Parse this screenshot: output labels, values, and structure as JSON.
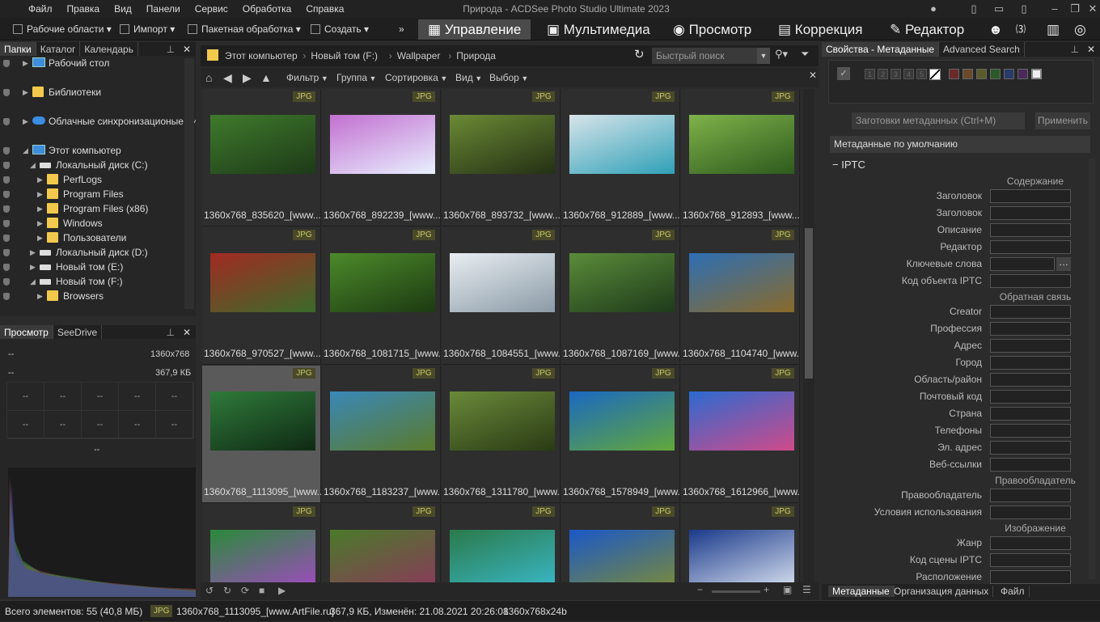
{
  "window": {
    "title": "Природа - ACDSee Photo Studio Ultimate 2023"
  },
  "menu": [
    "Файл",
    "Правка",
    "Вид",
    "Панели",
    "Сервис",
    "Обработка",
    "Справка"
  ],
  "toolbar": {
    "workspaces": "Рабочие области",
    "import": "Импорт",
    "batch": "Пакетная обработка",
    "create": "Создать",
    "more": "»"
  },
  "modes": [
    "Управление",
    "Мультимедиа",
    "Просмотр",
    "Коррекция",
    "Редактор"
  ],
  "left_tabs": [
    "Папки",
    "Каталог",
    "Календарь"
  ],
  "tree": [
    {
      "label": "Рабочий стол",
      "indent": 0,
      "icon": "desktop"
    },
    {
      "label": "Библиотеки",
      "indent": 0,
      "icon": "folder"
    },
    {
      "label": "Облачные синхронизационые ди",
      "indent": 0,
      "icon": "cloud"
    },
    {
      "label": "Этот компьютер",
      "indent": 0,
      "icon": "computer"
    },
    {
      "label": "Локальный диск (C:)",
      "indent": 1,
      "icon": "drive"
    },
    {
      "label": "PerfLogs",
      "indent": 2,
      "icon": "folder"
    },
    {
      "label": "Program Files",
      "indent": 2,
      "icon": "folder"
    },
    {
      "label": "Program Files (x86)",
      "indent": 2,
      "icon": "folder"
    },
    {
      "label": "Windows",
      "indent": 2,
      "icon": "folder"
    },
    {
      "label": "Пользователи",
      "indent": 2,
      "icon": "folder"
    },
    {
      "label": "Локальный диск (D:)",
      "indent": 1,
      "icon": "drive"
    },
    {
      "label": "Новый том (E:)",
      "indent": 1,
      "icon": "drive"
    },
    {
      "label": "Новый том (F:)",
      "indent": 1,
      "icon": "drive"
    },
    {
      "label": "Browsers",
      "indent": 2,
      "icon": "folder"
    }
  ],
  "preview_tabs": [
    "Просмотр",
    "SeeDrive"
  ],
  "preview": {
    "dims": "1360x768",
    "size": "367,9 КБ",
    "dash": "--"
  },
  "breadcrumb": [
    "Этот компьютер",
    "Новый том (F:)",
    "Wallpaper",
    "Природа"
  ],
  "quick_search": {
    "placeholder": "Быстрый поиск"
  },
  "navbar": [
    "Фильтр",
    "Группа",
    "Сортировка",
    "Вид",
    "Выбор"
  ],
  "thumbs": [
    {
      "name": "1360x768_835620_[www....",
      "badge": "JPG",
      "c1": "#3f7a2c",
      "c2": "#1d3a18"
    },
    {
      "name": "1360x768_892239_[www....",
      "badge": "JPG",
      "c1": "#c26fd0",
      "c2": "#e8f0ff"
    },
    {
      "name": "1360x768_893732_[www....",
      "badge": "JPG",
      "c1": "#6b8a35",
      "c2": "#243014"
    },
    {
      "name": "1360x768_912889_[www....",
      "badge": "JPG",
      "c1": "#d7e4ea",
      "c2": "#2fa0b7"
    },
    {
      "name": "1360x768_912893_[www....",
      "badge": "JPG",
      "c1": "#7fb24a",
      "c2": "#2d5a1d"
    },
    {
      "name": "1360x768_970527_[www....",
      "badge": "JPG",
      "c1": "#a22a22",
      "c2": "#3b6b2a"
    },
    {
      "name": "1360x768_1081715_[www....",
      "badge": "JPG",
      "c1": "#4c8a2a",
      "c2": "#1c3a12"
    },
    {
      "name": "1360x768_1084551_[www....",
      "badge": "JPG",
      "c1": "#e9eef2",
      "c2": "#8a9aa6"
    },
    {
      "name": "1360x768_1087169_[www....",
      "badge": "JPG",
      "c1": "#5a8c3a",
      "c2": "#1e3a1a"
    },
    {
      "name": "1360x768_1104740_[www....",
      "badge": "JPG",
      "c1": "#2d6fb5",
      "c2": "#8a6a2a"
    },
    {
      "name": "1360x768_1113095_[www....",
      "badge": "JPG",
      "c1": "#2f7a3a",
      "c2": "#0f2a14",
      "selected": true
    },
    {
      "name": "1360x768_1183237_[www....",
      "badge": "JPG",
      "c1": "#3a88b8",
      "c2": "#5a7a2a"
    },
    {
      "name": "1360x768_1311780_[www....",
      "badge": "JPG",
      "c1": "#6a8a3a",
      "c2": "#2a3a14"
    },
    {
      "name": "1360x768_1578949_[www....",
      "badge": "JPG",
      "c1": "#1a68c2",
      "c2": "#62a83a"
    },
    {
      "name": "1360x768_1612966_[www....",
      "badge": "JPG",
      "c1": "#2c6ad0",
      "c2": "#d04a8a"
    },
    {
      "name": "",
      "badge": "JPG",
      "c1": "#2a8a3a",
      "c2": "#a04ac0"
    },
    {
      "name": "",
      "badge": "JPG",
      "c1": "#4a7a2a",
      "c2": "#8a3a5a"
    },
    {
      "name": "",
      "badge": "JPG",
      "c1": "#2a7a4a",
      "c2": "#3ab8c8"
    },
    {
      "name": "",
      "badge": "JPG",
      "c1": "#1a58c8",
      "c2": "#7a8a3a"
    },
    {
      "name": "",
      "badge": "JPG",
      "c1": "#1a3a8a",
      "c2": "#d8e0f0"
    }
  ],
  "right_tabs": [
    "Свойства - Метаданные",
    "Advanced Search"
  ],
  "ratings": [
    "1",
    "2",
    "3",
    "4",
    "5"
  ],
  "presets": {
    "placeholder": "Заготовки метаданных (Ctrl+M)",
    "apply": "Применить",
    "default": "Метаданные по умолчанию"
  },
  "iptc": {
    "title": "IPTC",
    "sections": {
      "content": "Содержание",
      "feedback": "Обратная связь",
      "copyright": "Правообладатель",
      "image": "Изображение"
    },
    "fields_content": [
      "Заголовок",
      "Заголовок",
      "Описание",
      "Редактор",
      "Ключевые слова",
      "Код объекта IPTC"
    ],
    "fields_feedback": [
      "Creator",
      "Профессия",
      "Адрес",
      "Город",
      "Область/район",
      "Почтовый код",
      "Страна",
      "Телефоны",
      "Эл. адрес",
      "Веб-ссылки"
    ],
    "fields_copyright": [
      "Правообладатель",
      "Условия использования"
    ],
    "fields_image": [
      "Жанр",
      "Код сцены IPTC",
      "Расположение"
    ]
  },
  "bottom_tabs": [
    "Метаданные",
    "Организация данных",
    "Файл"
  ],
  "status": {
    "count": "Всего элементов: 55  (40,8 МБ)",
    "badge": "JPG",
    "file": "1360x768_1113095_[www.ArtFile.ru]",
    "info": "367,9 КБ, Изменён: 21.08.2021 20:26:08",
    "dims": "1360x768x24b"
  }
}
